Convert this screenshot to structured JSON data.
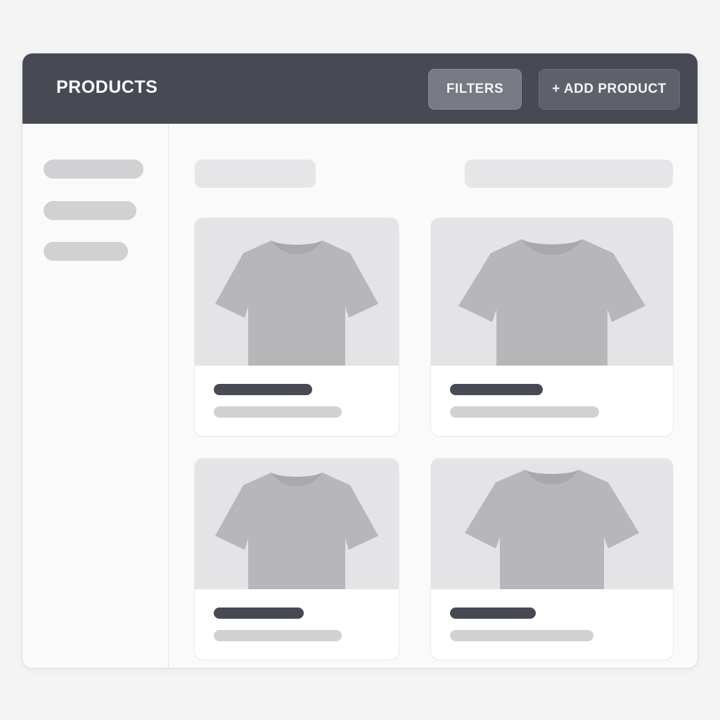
{
  "header": {
    "title": "PRODUCTS",
    "filters_label": "FILTERS",
    "add_product_label": "+ ADD PRODUCT"
  },
  "colors": {
    "header_bg": "#474a53",
    "placeholder_dark": "#474a53",
    "placeholder_light": "#d1d1d4",
    "image_bg": "#e4e4e6",
    "shirt": "#b7b7ba"
  },
  "products": [
    {
      "image_icon": "tshirt-icon"
    },
    {
      "image_icon": "tshirt-icon"
    },
    {
      "image_icon": "tshirt-icon"
    },
    {
      "image_icon": "tshirt-icon"
    }
  ]
}
